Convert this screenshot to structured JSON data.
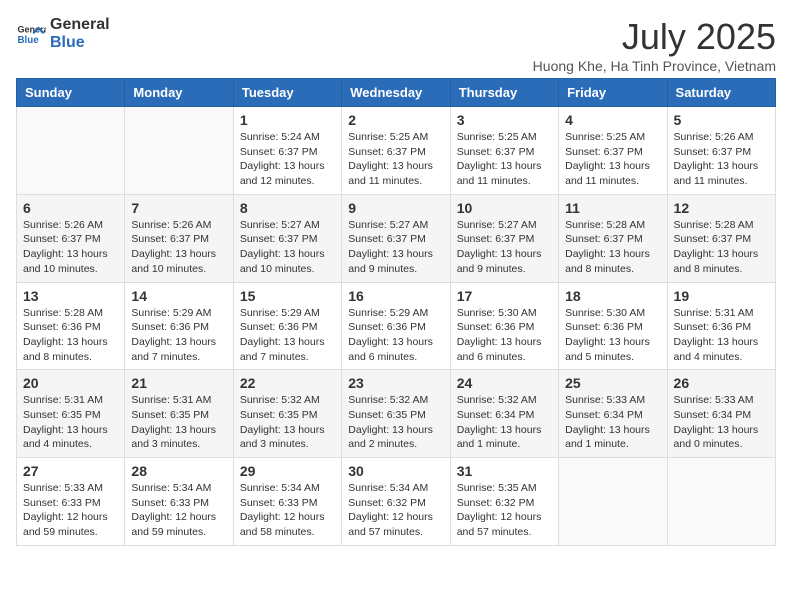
{
  "header": {
    "logo_general": "General",
    "logo_blue": "Blue",
    "title": "July 2025",
    "subtitle": "Huong Khe, Ha Tinh Province, Vietnam"
  },
  "columns": [
    "Sunday",
    "Monday",
    "Tuesday",
    "Wednesday",
    "Thursday",
    "Friday",
    "Saturday"
  ],
  "weeks": [
    [
      {
        "day": "",
        "sunrise": "",
        "sunset": "",
        "daylight": ""
      },
      {
        "day": "",
        "sunrise": "",
        "sunset": "",
        "daylight": ""
      },
      {
        "day": "1",
        "sunrise": "Sunrise: 5:24 AM",
        "sunset": "Sunset: 6:37 PM",
        "daylight": "Daylight: 13 hours and 12 minutes."
      },
      {
        "day": "2",
        "sunrise": "Sunrise: 5:25 AM",
        "sunset": "Sunset: 6:37 PM",
        "daylight": "Daylight: 13 hours and 11 minutes."
      },
      {
        "day": "3",
        "sunrise": "Sunrise: 5:25 AM",
        "sunset": "Sunset: 6:37 PM",
        "daylight": "Daylight: 13 hours and 11 minutes."
      },
      {
        "day": "4",
        "sunrise": "Sunrise: 5:25 AM",
        "sunset": "Sunset: 6:37 PM",
        "daylight": "Daylight: 13 hours and 11 minutes."
      },
      {
        "day": "5",
        "sunrise": "Sunrise: 5:26 AM",
        "sunset": "Sunset: 6:37 PM",
        "daylight": "Daylight: 13 hours and 11 minutes."
      }
    ],
    [
      {
        "day": "6",
        "sunrise": "Sunrise: 5:26 AM",
        "sunset": "Sunset: 6:37 PM",
        "daylight": "Daylight: 13 hours and 10 minutes."
      },
      {
        "day": "7",
        "sunrise": "Sunrise: 5:26 AM",
        "sunset": "Sunset: 6:37 PM",
        "daylight": "Daylight: 13 hours and 10 minutes."
      },
      {
        "day": "8",
        "sunrise": "Sunrise: 5:27 AM",
        "sunset": "Sunset: 6:37 PM",
        "daylight": "Daylight: 13 hours and 10 minutes."
      },
      {
        "day": "9",
        "sunrise": "Sunrise: 5:27 AM",
        "sunset": "Sunset: 6:37 PM",
        "daylight": "Daylight: 13 hours and 9 minutes."
      },
      {
        "day": "10",
        "sunrise": "Sunrise: 5:27 AM",
        "sunset": "Sunset: 6:37 PM",
        "daylight": "Daylight: 13 hours and 9 minutes."
      },
      {
        "day": "11",
        "sunrise": "Sunrise: 5:28 AM",
        "sunset": "Sunset: 6:37 PM",
        "daylight": "Daylight: 13 hours and 8 minutes."
      },
      {
        "day": "12",
        "sunrise": "Sunrise: 5:28 AM",
        "sunset": "Sunset: 6:37 PM",
        "daylight": "Daylight: 13 hours and 8 minutes."
      }
    ],
    [
      {
        "day": "13",
        "sunrise": "Sunrise: 5:28 AM",
        "sunset": "Sunset: 6:36 PM",
        "daylight": "Daylight: 13 hours and 8 minutes."
      },
      {
        "day": "14",
        "sunrise": "Sunrise: 5:29 AM",
        "sunset": "Sunset: 6:36 PM",
        "daylight": "Daylight: 13 hours and 7 minutes."
      },
      {
        "day": "15",
        "sunrise": "Sunrise: 5:29 AM",
        "sunset": "Sunset: 6:36 PM",
        "daylight": "Daylight: 13 hours and 7 minutes."
      },
      {
        "day": "16",
        "sunrise": "Sunrise: 5:29 AM",
        "sunset": "Sunset: 6:36 PM",
        "daylight": "Daylight: 13 hours and 6 minutes."
      },
      {
        "day": "17",
        "sunrise": "Sunrise: 5:30 AM",
        "sunset": "Sunset: 6:36 PM",
        "daylight": "Daylight: 13 hours and 6 minutes."
      },
      {
        "day": "18",
        "sunrise": "Sunrise: 5:30 AM",
        "sunset": "Sunset: 6:36 PM",
        "daylight": "Daylight: 13 hours and 5 minutes."
      },
      {
        "day": "19",
        "sunrise": "Sunrise: 5:31 AM",
        "sunset": "Sunset: 6:36 PM",
        "daylight": "Daylight: 13 hours and 4 minutes."
      }
    ],
    [
      {
        "day": "20",
        "sunrise": "Sunrise: 5:31 AM",
        "sunset": "Sunset: 6:35 PM",
        "daylight": "Daylight: 13 hours and 4 minutes."
      },
      {
        "day": "21",
        "sunrise": "Sunrise: 5:31 AM",
        "sunset": "Sunset: 6:35 PM",
        "daylight": "Daylight: 13 hours and 3 minutes."
      },
      {
        "day": "22",
        "sunrise": "Sunrise: 5:32 AM",
        "sunset": "Sunset: 6:35 PM",
        "daylight": "Daylight: 13 hours and 3 minutes."
      },
      {
        "day": "23",
        "sunrise": "Sunrise: 5:32 AM",
        "sunset": "Sunset: 6:35 PM",
        "daylight": "Daylight: 13 hours and 2 minutes."
      },
      {
        "day": "24",
        "sunrise": "Sunrise: 5:32 AM",
        "sunset": "Sunset: 6:34 PM",
        "daylight": "Daylight: 13 hours and 1 minute."
      },
      {
        "day": "25",
        "sunrise": "Sunrise: 5:33 AM",
        "sunset": "Sunset: 6:34 PM",
        "daylight": "Daylight: 13 hours and 1 minute."
      },
      {
        "day": "26",
        "sunrise": "Sunrise: 5:33 AM",
        "sunset": "Sunset: 6:34 PM",
        "daylight": "Daylight: 13 hours and 0 minutes."
      }
    ],
    [
      {
        "day": "27",
        "sunrise": "Sunrise: 5:33 AM",
        "sunset": "Sunset: 6:33 PM",
        "daylight": "Daylight: 12 hours and 59 minutes."
      },
      {
        "day": "28",
        "sunrise": "Sunrise: 5:34 AM",
        "sunset": "Sunset: 6:33 PM",
        "daylight": "Daylight: 12 hours and 59 minutes."
      },
      {
        "day": "29",
        "sunrise": "Sunrise: 5:34 AM",
        "sunset": "Sunset: 6:33 PM",
        "daylight": "Daylight: 12 hours and 58 minutes."
      },
      {
        "day": "30",
        "sunrise": "Sunrise: 5:34 AM",
        "sunset": "Sunset: 6:32 PM",
        "daylight": "Daylight: 12 hours and 57 minutes."
      },
      {
        "day": "31",
        "sunrise": "Sunrise: 5:35 AM",
        "sunset": "Sunset: 6:32 PM",
        "daylight": "Daylight: 12 hours and 57 minutes."
      },
      {
        "day": "",
        "sunrise": "",
        "sunset": "",
        "daylight": ""
      },
      {
        "day": "",
        "sunrise": "",
        "sunset": "",
        "daylight": ""
      }
    ]
  ]
}
